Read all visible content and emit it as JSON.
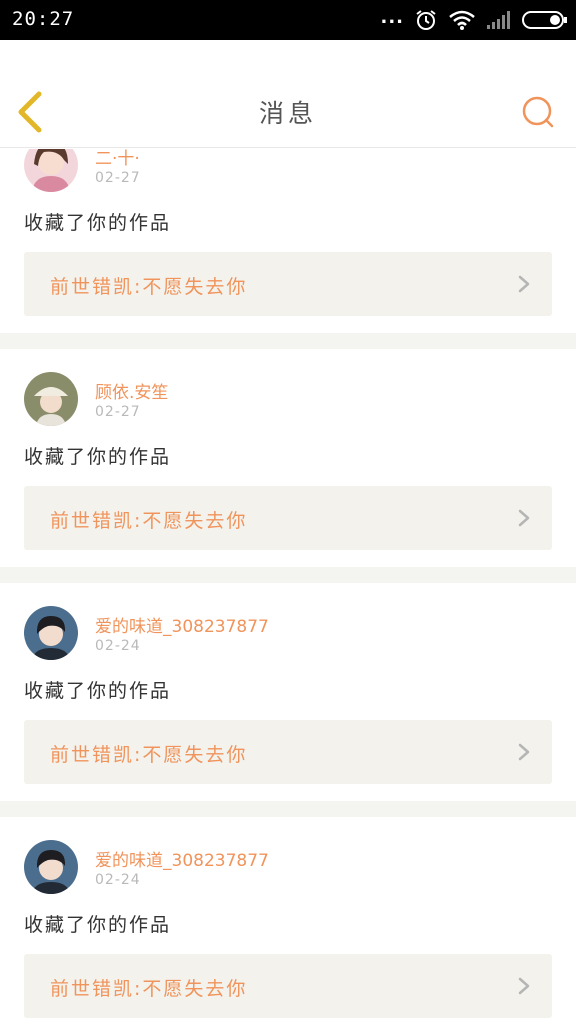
{
  "status_bar": {
    "time": "20:27",
    "dots": "...",
    "icons": [
      "alarm-icon",
      "wifi-icon",
      "signal-icon",
      "battery-icon"
    ]
  },
  "header": {
    "title": "消息",
    "back_icon": "chevron-left-icon",
    "search_icon": "search-icon"
  },
  "colors": {
    "accent": "#f0945c",
    "back_icon": "#e3b72a",
    "card_bg": "#f3f2ec",
    "separator": "#f4f4f1",
    "text": "#333333",
    "date": "#b9b9b9"
  },
  "messages": [
    {
      "username": "二·十·",
      "date": "02-27",
      "action": "收藏了你的作品",
      "work_title": "前世错凯:不愿失去你",
      "avatar_icon": "avatar-girl"
    },
    {
      "username": "顾依.安笙",
      "date": "02-27",
      "action": "收藏了你的作品",
      "work_title": "前世错凯:不愿失去你",
      "avatar_icon": "avatar-boy-hat"
    },
    {
      "username": "爱的味道_308237877",
      "date": "02-24",
      "action": "收藏了你的作品",
      "work_title": "前世错凯:不愿失去你",
      "avatar_icon": "avatar-boy"
    },
    {
      "username": "爱的味道_308237877",
      "date": "02-24",
      "action": "收藏了你的作品",
      "work_title": "前世错凯:不愿失去你",
      "avatar_icon": "avatar-boy"
    }
  ]
}
